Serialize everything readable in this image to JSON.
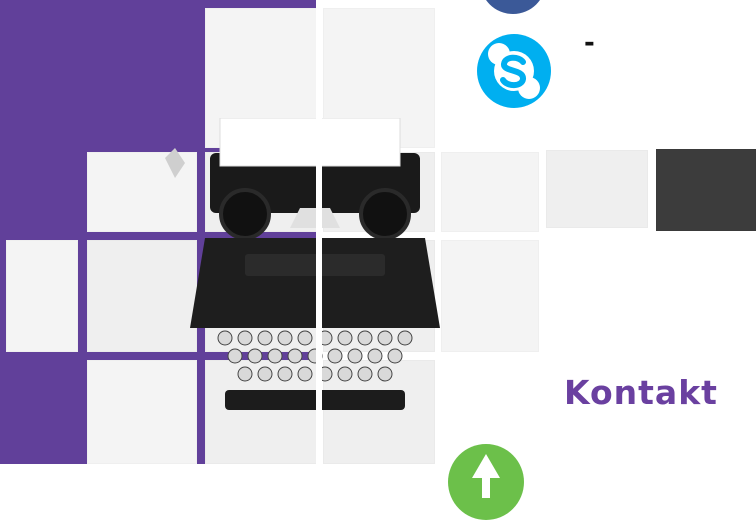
{
  "header": {
    "dash_text": "-"
  },
  "contact": {
    "title": "Kontakt"
  },
  "icons": {
    "top": "facebook-icon",
    "skype": "skype-icon",
    "bottom": "phone-icon"
  },
  "colors": {
    "purple": "#61409a",
    "kontakt_text": "#6a40a0",
    "skype_blue": "#00aff0",
    "green": "#6cc04a",
    "dark_tile": "#3c3c3c"
  }
}
